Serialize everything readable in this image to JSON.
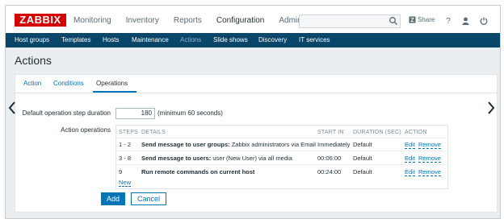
{
  "logo": "ZABBIX",
  "main_nav": [
    "Monitoring",
    "Inventory",
    "Reports",
    "Configuration",
    "Administration"
  ],
  "share_label": "Share",
  "help_label": "?",
  "sub_nav": [
    "Host groups",
    "Templates",
    "Hosts",
    "Maintenance",
    "Actions",
    "Slide shows",
    "Discovery",
    "IT services"
  ],
  "page_title": "Actions",
  "tabs": [
    "Action",
    "Conditions",
    "Operations"
  ],
  "form": {
    "step_duration_label": "Default operation step duration",
    "step_duration_value": "180",
    "step_duration_hint": "(minimum 60 seconds)",
    "action_operations_label": "Action operations"
  },
  "operations_table": {
    "headers": [
      "STEPS",
      "DETAILS",
      "START IN",
      "DURATION (SEC)",
      "ACTION"
    ],
    "rows": [
      {
        "steps": "1 - 2",
        "details_bold": "Send message to user groups:",
        "details_rest": " Zabbix administrators via Email",
        "start_in": "Immediately",
        "duration": "Default",
        "edit": "Edit",
        "remove": "Remove"
      },
      {
        "steps": "3 - 8",
        "details_bold": "Send message to users:",
        "details_rest": " user (New User) via all media",
        "start_in": "00:06:00",
        "duration": "Default",
        "edit": "Edit",
        "remove": "Remove"
      },
      {
        "steps": "9",
        "details_bold": "Run remote commands on current host",
        "details_rest": "",
        "start_in": "00:24:00",
        "duration": "Default",
        "edit": "Edit",
        "remove": "Remove"
      }
    ],
    "new_link": "New"
  },
  "buttons": {
    "add": "Add",
    "cancel": "Cancel"
  },
  "colors": {
    "brand": "#d40000",
    "subnav": "#0a466a",
    "link": "#0275b8"
  }
}
